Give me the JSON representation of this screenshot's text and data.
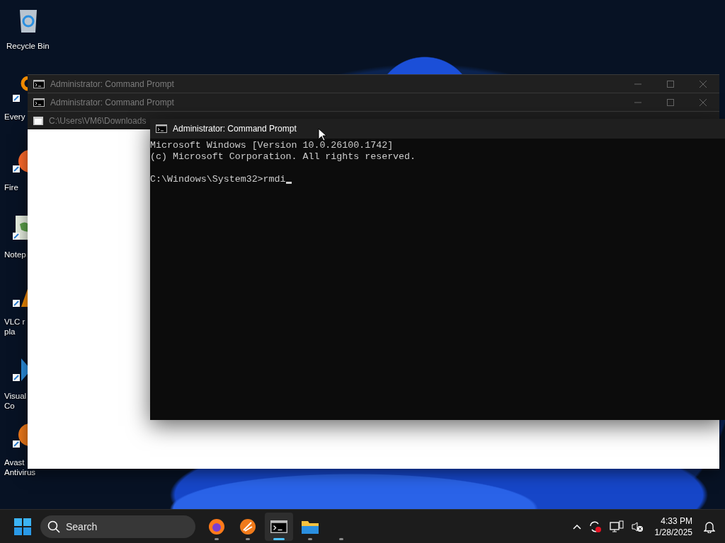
{
  "desktop_icons": [
    {
      "kind": "recycle",
      "lines": [
        "Recycle Bin"
      ]
    },
    {
      "kind": "search",
      "lines": [
        "Every"
      ]
    },
    {
      "kind": "firefox",
      "lines": [
        "Fire"
      ]
    },
    {
      "kind": "notepad",
      "lines": [
        "Notep"
      ]
    },
    {
      "kind": "vlc",
      "lines": [
        "VLC r",
        "pla"
      ]
    },
    {
      "kind": "vscode",
      "lines": [
        "Visual",
        "Co"
      ]
    },
    {
      "kind": "avast",
      "lines": [
        "Avast",
        "Antivirus"
      ]
    }
  ],
  "windows": [
    {
      "kind": "console",
      "title": "Administrator: Command Prompt",
      "active": false
    },
    {
      "kind": "console",
      "title": "Administrator: Command Prompt",
      "active": false
    },
    {
      "kind": "explorer",
      "title": "C:\\Users\\VM6\\Downloads",
      "active": false
    }
  ],
  "console_window": {
    "title": "Administrator: Command Prompt",
    "active": true,
    "banner": [
      "Microsoft Windows [Version 10.0.26100.1742]",
      "(c) Microsoft Corporation. All rights reserved."
    ],
    "prompt": "C:\\Windows\\System32>rmdi",
    "cursor": true
  },
  "taskbar": {
    "search": {
      "placeholder": "Search"
    },
    "apps": [
      {
        "kind": "firefox",
        "selected": false
      },
      {
        "kind": "avast",
        "selected": false
      },
      {
        "kind": "console",
        "selected": true
      },
      {
        "kind": "folder",
        "selected": false
      },
      {
        "kind": "empty",
        "selected": false
      }
    ],
    "clock": {
      "time": "4:33 PM",
      "date": "1/28/2025"
    }
  }
}
